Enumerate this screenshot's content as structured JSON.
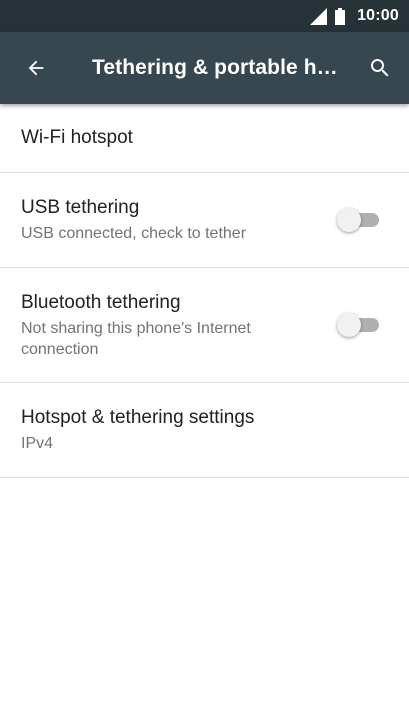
{
  "status_bar": {
    "time": "10:00",
    "icons": [
      "signal-icon",
      "battery-icon"
    ]
  },
  "app_bar": {
    "title": "Tethering & portable h…",
    "back_icon": "arrow-back-icon",
    "search_icon": "search-icon"
  },
  "items": [
    {
      "title": "Wi-Fi hotspot"
    },
    {
      "title": "USB tethering",
      "summary": "USB connected, check to tether",
      "toggle": "off"
    },
    {
      "title": "Bluetooth tethering",
      "summary": "Not sharing this phone's Internet connection",
      "toggle": "off"
    },
    {
      "title": "Hotspot & tethering settings",
      "summary": "IPv4"
    }
  ],
  "colors": {
    "status_bar": "#263238",
    "app_bar": "#37474f",
    "toggle_off_track": "#b0b0b0",
    "toggle_off_thumb": "#f1f1f1"
  }
}
